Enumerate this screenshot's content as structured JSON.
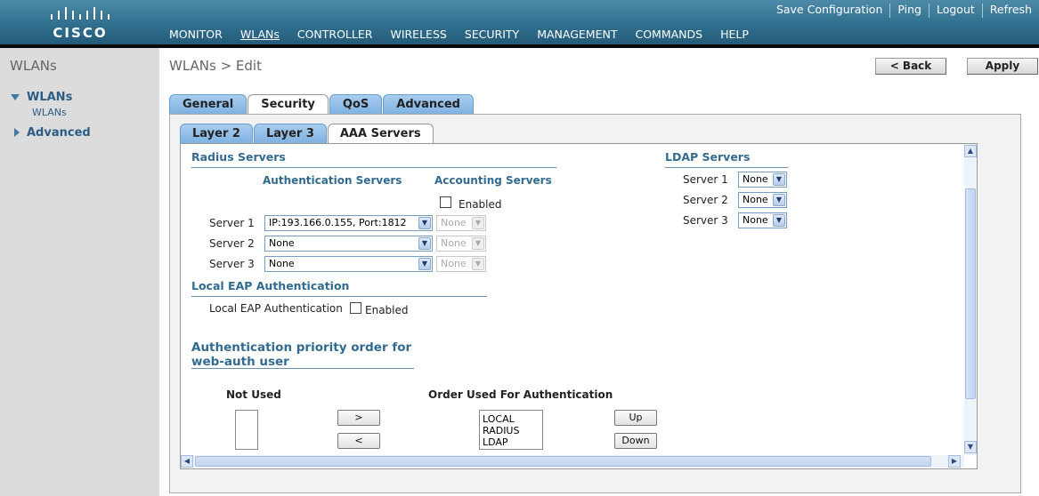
{
  "header": {
    "brand": "CISCO",
    "util_links": [
      "Save Configuration",
      "Ping",
      "Logout",
      "Refresh"
    ],
    "nav": [
      "MONITOR",
      "WLANs",
      "CONTROLLER",
      "WIRELESS",
      "SECURITY",
      "MANAGEMENT",
      "COMMANDS",
      "HELP"
    ]
  },
  "sidebar": {
    "title": "WLANs",
    "items": [
      {
        "label": "WLANs",
        "sub": "WLANs"
      },
      {
        "label": "Advanced"
      }
    ]
  },
  "page": {
    "title": "WLANs > Edit",
    "back_label": "< Back",
    "apply_label": "Apply"
  },
  "tabs": [
    "General",
    "Security",
    "QoS",
    "Advanced"
  ],
  "subtabs": [
    "Layer 2",
    "Layer 3",
    "AAA Servers"
  ],
  "radius": {
    "title": "Radius Servers",
    "auth_head": "Authentication Servers",
    "acct_head": "Accounting Servers",
    "enabled_label": "Enabled",
    "servers": [
      {
        "label": "Server 1",
        "auth": "IP:193.166.0.155, Port:1812",
        "acct": "None"
      },
      {
        "label": "Server 2",
        "auth": "None",
        "acct": "None"
      },
      {
        "label": "Server 3",
        "auth": "None",
        "acct": "None"
      }
    ]
  },
  "ldap": {
    "title": "LDAP Servers",
    "servers": [
      {
        "label": "Server 1",
        "value": "None"
      },
      {
        "label": "Server 2",
        "value": "None"
      },
      {
        "label": "Server 3",
        "value": "None"
      }
    ]
  },
  "local_eap": {
    "title": "Local EAP Authentication",
    "label": "Local EAP Authentication",
    "enabled_label": "Enabled"
  },
  "priority": {
    "title_line1": "Authentication priority order for",
    "title_line2": "web-auth user",
    "not_used_head": "Not Used",
    "order_head": "Order Used For Authentication",
    "move_right": ">",
    "move_left": "<",
    "up": "Up",
    "down": "Down",
    "order_items": [
      "LOCAL",
      "RADIUS",
      "LDAP"
    ]
  }
}
